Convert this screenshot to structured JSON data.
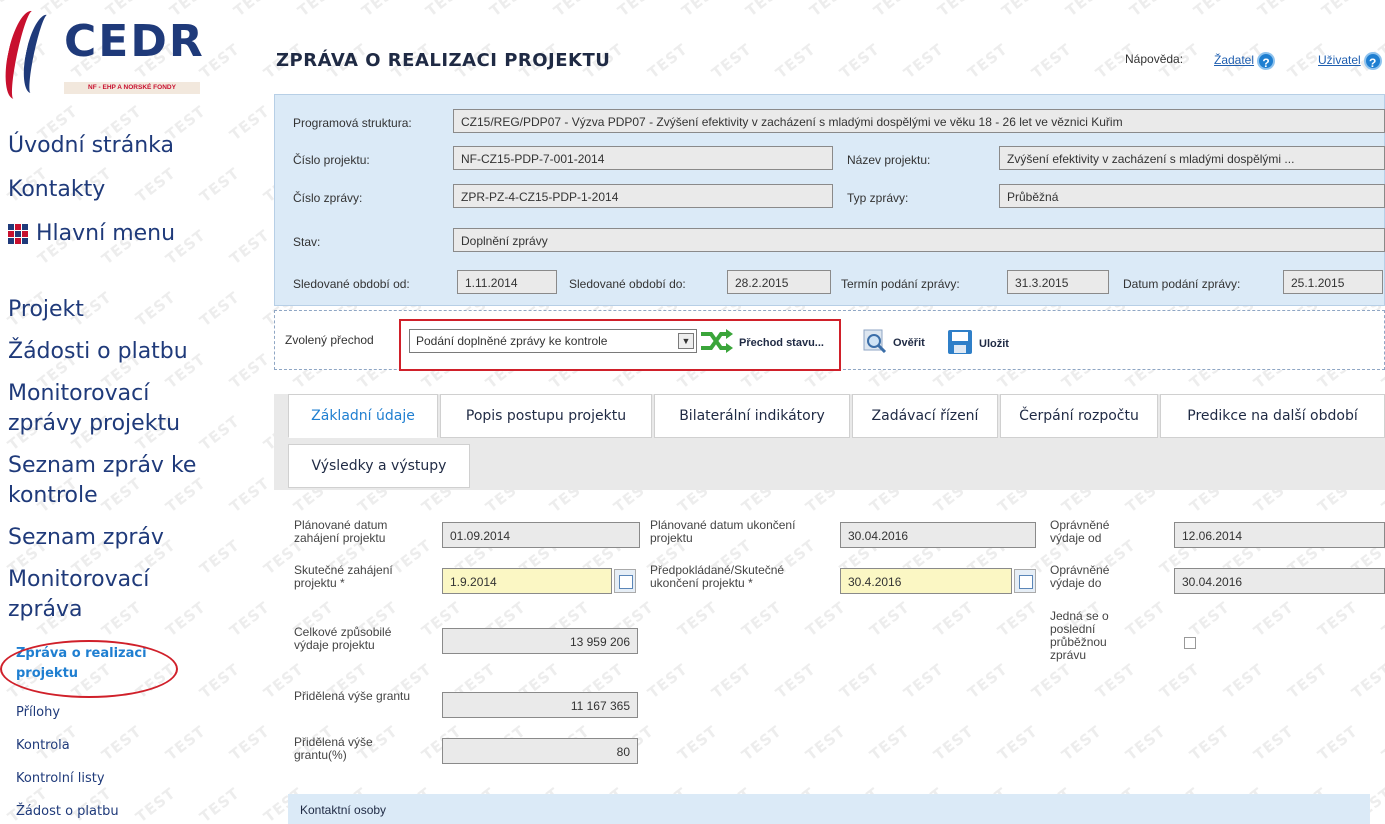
{
  "sidebar": {
    "logo_text": "CEDR",
    "logo_subtitle": "NF - EHP A NORSKÉ FONDY",
    "top_links": [
      "Úvodní stránka",
      "Kontakty",
      "Hlavní menu"
    ],
    "section_links": [
      "Projekt",
      "Žádosti o platbu",
      "Monitorovací",
      "zprávy projektu",
      "Seznam zpráv ke",
      "kontrole",
      "Seznam zpráv",
      "Monitorovací",
      "zpráva"
    ],
    "sub_links": [
      "Zpráva o realizaci",
      "projektu",
      "Přílohy",
      "Kontrola",
      "Kontrolní listy",
      "Žádost o platbu"
    ]
  },
  "header": {
    "title": "ZPRÁVA O REALIZACI PROJEKTU",
    "help_label": "Nápověda:",
    "help_applicant": "Žadatel",
    "help_user": "Uživatel"
  },
  "summary": {
    "program_label": "Programová struktura:",
    "program_value": "CZ15/REG/PDP07 - Výzva PDP07 - Zvýšení efektivity v zacházení s mladými dospělými ve věku 18 - 26 let ve věznici Kuřim",
    "project_no_label": "Číslo projektu:",
    "project_no_value": "NF-CZ15-PDP-7-001-2014",
    "project_name_label": "Název projektu:",
    "project_name_value": "Zvýšení efektivity v zacházení s mladými dospělými ...",
    "report_no_label": "Číslo zprávy:",
    "report_no_value": "ZPR-PZ-4-CZ15-PDP-1-2014",
    "report_type_label": "Typ zprávy:",
    "report_type_value": "Průběžná",
    "state_label": "Stav:",
    "state_value": "Doplnění zprávy",
    "period_from_label": "Sledované období od:",
    "period_from_value": "1.11.2014",
    "period_to_label": "Sledované období do:",
    "period_to_value": "28.2.2015",
    "deadline_label": "Termín podání zprávy:",
    "deadline_value": "31.3.2015",
    "submitted_label": "Datum podání zprávy:",
    "submitted_value": "25.1.2015"
  },
  "toolbar": {
    "transition_label": "Zvolený přechod",
    "transition_value": "Podání doplněné zprávy ke kontrole",
    "transition_button": "Přechod stavu...",
    "verify_button": "Ověřit",
    "save_button": "Uložit"
  },
  "tabs": [
    "Základní údaje",
    "Popis postupu projektu",
    "Bilaterální indikátory",
    "Zadávací řízení",
    "Čerpání rozpočtu",
    "Predikce na další období",
    "Výsledky a výstupy"
  ],
  "form": {
    "planned_start_label": "Plánované datum zahájení projektu",
    "planned_start_value": "01.09.2014",
    "planned_end_label": "Plánované datum ukončení projektu",
    "planned_end_value": "30.04.2016",
    "eligible_from_label": "Oprávněné výdaje od",
    "eligible_from_value": "12.06.2014",
    "actual_start_label": "Skutečné zahájení projektu *",
    "actual_start_value": "1.9.2014",
    "actual_end_label": "Předpokládané/Skutečné ukončení projektu *",
    "actual_end_value": "30.4.2016",
    "eligible_to_label": "Oprávněné výdaje do",
    "eligible_to_value": "30.04.2016",
    "total_cost_label": "Celkové způsobilé výdaje projektu",
    "total_cost_value": "13 959 206",
    "last_report_label": "Jedná se o poslední průběžnou zprávu",
    "grant_label": "Přidělená výše grantu",
    "grant_value": "11 167 365",
    "grant_pct_label": "Přidělená výše grantu(%)",
    "grant_pct_value": "80",
    "contacts_label": "Kontaktní osoby"
  },
  "watermark": "TEST",
  "colors": {
    "brand_blue": "#1f3a7a",
    "brand_red": "#c8102e",
    "link_blue": "#1f7fd1",
    "panel_blue": "#dbeaf7",
    "highlight_red": "#d0202a",
    "required_yellow": "#fbf7c4"
  }
}
